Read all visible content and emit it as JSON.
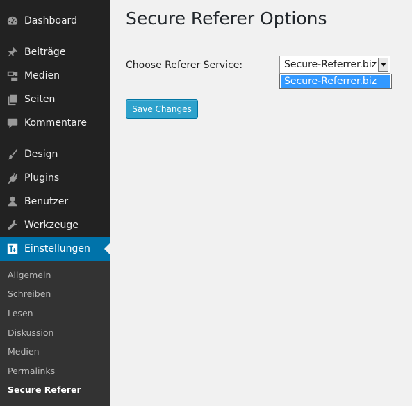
{
  "sidebar": {
    "items": [
      {
        "label": "Dashboard",
        "icon": "dashboard-icon"
      },
      {
        "label": "Beiträge",
        "icon": "pin-icon"
      },
      {
        "label": "Medien",
        "icon": "media-icon"
      },
      {
        "label": "Seiten",
        "icon": "pages-icon"
      },
      {
        "label": "Kommentare",
        "icon": "comment-icon"
      },
      {
        "label": "Design",
        "icon": "brush-icon"
      },
      {
        "label": "Plugins",
        "icon": "plugin-icon"
      },
      {
        "label": "Benutzer",
        "icon": "user-icon"
      },
      {
        "label": "Werkzeuge",
        "icon": "wrench-icon"
      },
      {
        "label": "Einstellungen",
        "icon": "settings-icon",
        "active": true
      }
    ],
    "submenu": [
      {
        "label": "Allgemein"
      },
      {
        "label": "Schreiben"
      },
      {
        "label": "Lesen"
      },
      {
        "label": "Diskussion"
      },
      {
        "label": "Medien"
      },
      {
        "label": "Permalinks"
      },
      {
        "label": "Secure Referer",
        "current": true
      }
    ]
  },
  "main": {
    "title": "Secure Referer Options",
    "field_label": "Choose Referer Service:",
    "select": {
      "value": "Secure-Referrer.biz",
      "options": [
        "Secure-Referrer.biz"
      ]
    },
    "save_label": "Save Changes"
  },
  "colors": {
    "sidebar_bg": "#222222",
    "submenu_bg": "#333333",
    "active_bg": "#0073aa",
    "button_bg": "#2ea2cc",
    "option_highlight": "#3399ff"
  }
}
